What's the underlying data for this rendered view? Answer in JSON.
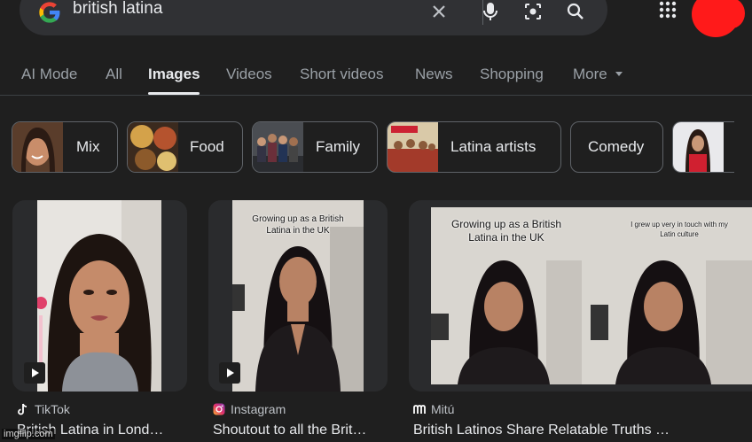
{
  "search": {
    "query": "british latina"
  },
  "tabs": [
    {
      "label": "AI Mode"
    },
    {
      "label": "All"
    },
    {
      "label": "Images"
    },
    {
      "label": "Videos"
    },
    {
      "label": "Short videos"
    },
    {
      "label": "News"
    },
    {
      "label": "Shopping"
    },
    {
      "label": "More"
    }
  ],
  "active_tab": "Images",
  "chips": [
    {
      "label": "Mix"
    },
    {
      "label": "Food"
    },
    {
      "label": "Family"
    },
    {
      "label": "Latina artists"
    },
    {
      "label": "Comedy"
    }
  ],
  "results": [
    {
      "source": "TikTok",
      "title": "British Latina in Lond…",
      "icon": "tiktok-icon"
    },
    {
      "source": "Instagram",
      "title": "Shoutout to all the Brit…",
      "icon": "instagram-icon",
      "overlay": "Growing up as a British Latina in the UK"
    },
    {
      "source": "Mitú",
      "title": "British Latinos Share Relatable Truths …",
      "icon": "mitu-icon",
      "overlay": "Growing up as a British Latina in the UK",
      "overlay2": "I grew up very in touch with my Latin culture"
    }
  ],
  "watermark": "imgflip.com",
  "colors": {
    "background": "#1f1f1f",
    "searchbar": "#303134",
    "avatar": "#ff1a1a"
  }
}
